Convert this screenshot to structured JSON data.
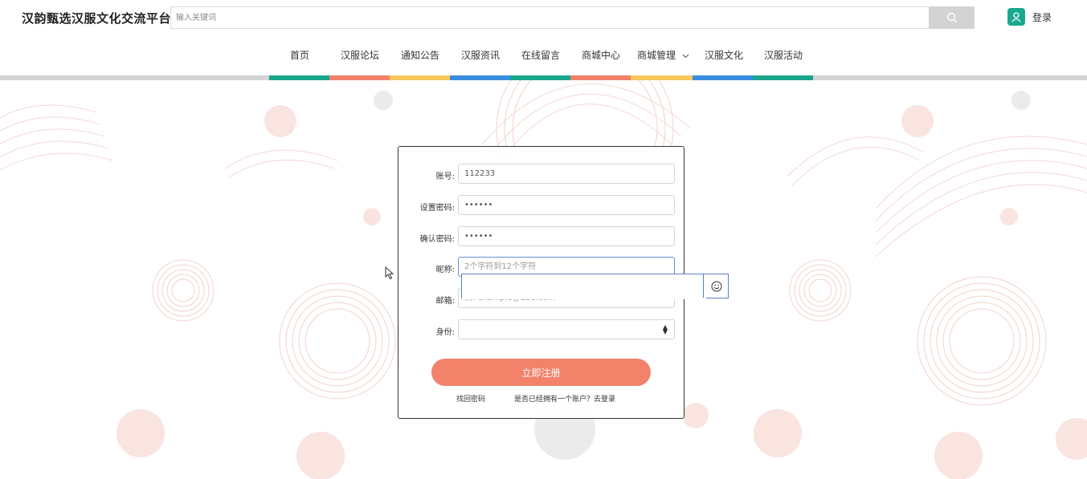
{
  "header": {
    "site_title": "汉韵甄选汉服文化交流平台",
    "search": {
      "placeholder": "输入关键词",
      "value": ""
    },
    "login_label": "登录"
  },
  "nav": {
    "items": [
      {
        "label": "首页",
        "color": "#1aa58c"
      },
      {
        "label": "汉服论坛",
        "color": "#f2826a"
      },
      {
        "label": "通知公告",
        "color": "#f7c85e"
      },
      {
        "label": "汉服资讯",
        "color": "#3a8ee0"
      },
      {
        "label": "在线留言",
        "color": "#1aa58c"
      },
      {
        "label": "商城中心",
        "color": "#f2826a"
      },
      {
        "label": "商城管理",
        "color": "#f7c85e"
      },
      {
        "label": "汉服文化",
        "color": "#3a8ee0"
      },
      {
        "label": "汉服活动",
        "color": "#1aa58c"
      }
    ]
  },
  "form": {
    "account_label": "账号:",
    "account_value": "112233",
    "password_label": "设置密码:",
    "password_value": "••••••",
    "confirm_label": "确认密码:",
    "confirm_value": "••••••",
    "nickname_label": "昵称:",
    "nickname_placeholder": "2个字符到12个字符",
    "email_label": "邮箱:",
    "email_placeholder": "例: example@126.com",
    "role_label": "身份:",
    "role_value": "",
    "submit_label": "立即注册",
    "forgot_label": "找回密码",
    "have_account_label": "是否已经拥有一个账户？去登录"
  },
  "colors": {
    "accent_green": "#1aa58c",
    "accent_orange": "#f2826a",
    "accent_yellow": "#f7c85e",
    "accent_blue": "#3a8ee0",
    "search_button": "#d3d3d3"
  },
  "icons": [
    "search-icon",
    "user-icon",
    "chevron-down-icon",
    "select-caret-icon",
    "smiley-icon",
    "mouse-cursor-icon"
  ]
}
